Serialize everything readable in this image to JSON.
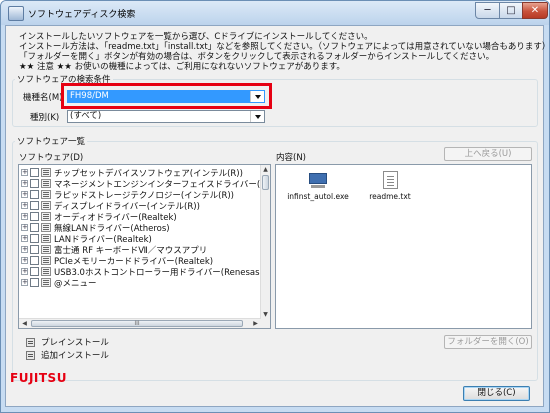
{
  "window": {
    "title": "ソフトウェアディスク検索",
    "controls": {
      "minimize": "─",
      "maximize": "□",
      "close": "✕"
    }
  },
  "instructions": [
    "インストールしたいソフトウェアを一覧から選び、Cドライブにインストールしてください。",
    "インストール方法は、「readme.txt」「install.txt」などを参照してください。（ソフトウェアによっては用意されていない場合もあります）",
    "「フォルダーを開く」ボタンが有効の場合は、ボタンをクリックして表示されるフォルダーからインストールしてください。",
    "★★ 注意 ★★ お使いの機種によっては、ご利用になれないソフトウェアがあります。"
  ],
  "search": {
    "group_title": "ソフトウェアの検索条件",
    "model_label": "機種名(M)",
    "model_value": "FH98/DM",
    "type_label": "種別(K)",
    "type_value": "(すべて)"
  },
  "list": {
    "group_title": "ソフトウェア一覧",
    "software_label": "ソフトウェア(D)",
    "contents_label": "内容(N)",
    "back_button": "上へ戻る(U)",
    "items": [
      "チップセットデバイスソフトウェア(インテル(R))",
      "マネージメントエンジンインターフェイスドライバー(インテル(R))",
      "ラピッドストレージテクノロジー(インテル(R))",
      "ディスプレイドライバー(インテル(R))",
      "オーディオドライバー(Realtek)",
      "無線LANドライバー(Atheros)",
      "LANドライバー(Realtek)",
      "富士通 RF キーボードⅦ／マウスアプリ",
      "PCIeメモリーカードドライバー(Realtek)",
      "USB3.0ホストコントローラー用ドライバー(Renesas Electronics)",
      "@メニュー"
    ],
    "files": [
      "infinst_autol.exe",
      "readme.txt"
    ]
  },
  "actions": {
    "preinstall": "プレインストール",
    "add_install": "追加インストール",
    "open_folder": "フォルダーを開く(O)",
    "close": "閉じる(C)"
  },
  "brand": {
    "logo_text": "FUJITSU",
    "color": "#e60012"
  },
  "colors": {
    "selection": "#3399ff",
    "highlight_box": "#e60012"
  }
}
